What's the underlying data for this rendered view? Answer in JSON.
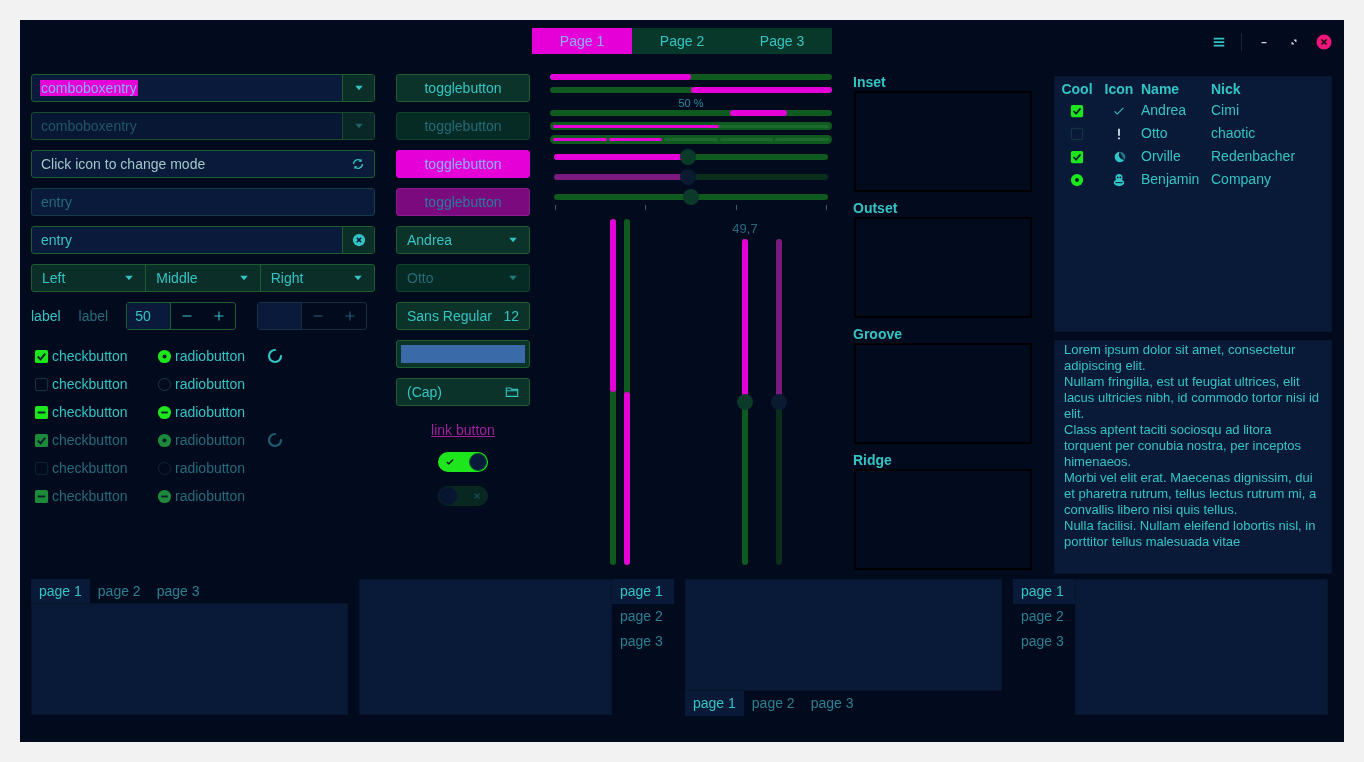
{
  "header": {
    "tabs": [
      {
        "label": "Page 1",
        "selected": true
      },
      {
        "label": "Page 2",
        "selected": false
      },
      {
        "label": "Page 3",
        "selected": false
      }
    ]
  },
  "left": {
    "combo_entries": [
      {
        "value": "comboboxentry",
        "text_selected": true,
        "disabled": false
      },
      {
        "value": "comboboxentry",
        "text_selected": false,
        "disabled": true
      }
    ],
    "mode_entry": {
      "value": "Click icon to change mode"
    },
    "placeholder_entry": {
      "placeholder": "entry"
    },
    "clear_entry": {
      "value": "entry"
    },
    "linked_combos": [
      {
        "label": "Left"
      },
      {
        "label": "Middle"
      },
      {
        "label": "Right"
      }
    ],
    "labels": [
      {
        "text": "label",
        "disabled": false
      },
      {
        "text": "label",
        "disabled": true
      }
    ],
    "spin_buttons": [
      {
        "value": "50",
        "disabled": false
      },
      {
        "disabled": true
      }
    ],
    "check_rows": [
      {
        "check_label": "checkbutton",
        "checked": true,
        "inconsistent": false,
        "radio_label": "radiobutton",
        "radio_selected": true,
        "spinner": true,
        "disabled": false
      },
      {
        "check_label": "checkbutton",
        "checked": false,
        "inconsistent": false,
        "radio_label": "radiobutton",
        "radio_selected": false,
        "spinner": false,
        "disabled": false
      },
      {
        "check_label": "checkbutton",
        "inconsistent": true,
        "radio_label": "radiobutton",
        "spinner": false,
        "disabled": false
      },
      {
        "check_label": "checkbutton",
        "checked": true,
        "inconsistent": false,
        "radio_label": "radiobutton",
        "radio_selected": true,
        "spinner": true,
        "disabled": true
      },
      {
        "check_label": "checkbutton",
        "checked": false,
        "inconsistent": false,
        "radio_label": "radiobutton",
        "radio_selected": false,
        "spinner": false,
        "disabled": true
      },
      {
        "check_label": "checkbutton",
        "inconsistent": true,
        "radio_label": "radiobutton",
        "spinner": false,
        "disabled": true
      }
    ]
  },
  "middle": {
    "toggle_buttons": [
      {
        "label": "togglebutton",
        "active": false,
        "disabled": false
      },
      {
        "label": "togglebutton",
        "active": false,
        "disabled": true
      },
      {
        "label": "togglebutton",
        "active": true,
        "disabled": false
      },
      {
        "label": "togglebutton",
        "active": true,
        "disabled": true
      }
    ],
    "combos": [
      {
        "value": "Andrea",
        "disabled": false
      },
      {
        "value": "Otto",
        "disabled": true
      }
    ],
    "font_button": {
      "font": "Sans Regular",
      "size": "12"
    },
    "color_button": {
      "color": "#3a6aa8"
    },
    "file_button": {
      "label": "(Cap)"
    },
    "link_button": {
      "label": "link button"
    },
    "switches": [
      {
        "on": true,
        "disabled": false
      },
      {
        "on": false,
        "disabled": true
      }
    ]
  },
  "progress": {
    "bars": [
      {
        "kind": "bar",
        "level": 0.5,
        "inverted": false
      },
      {
        "kind": "bar",
        "level": 0.5,
        "inverted": true
      },
      {
        "kind": "pulse",
        "text": "50 %"
      },
      {
        "kind": "thick",
        "level": 0.6
      },
      {
        "kind": "segmented",
        "level": 0.4
      }
    ],
    "scales": [
      {
        "level": 0.49,
        "filled": true,
        "disabled": false
      },
      {
        "level": 0.49,
        "filled": true,
        "disabled": true
      },
      {
        "level": 0.5,
        "filled": false,
        "disabled": false,
        "marks": true
      }
    ],
    "vertical_bars": [
      {
        "level": 0.5,
        "inverted": false
      },
      {
        "level": 0.5,
        "inverted": true
      }
    ],
    "vertical_scales": [
      {
        "level": 0.5,
        "value": "49,7",
        "disabled": false
      },
      {
        "level": 0.5,
        "disabled": true
      }
    ]
  },
  "frames": [
    {
      "label": "Inset"
    },
    {
      "label": "Outset"
    },
    {
      "label": "Groove"
    },
    {
      "label": "Ridge"
    }
  ],
  "tree": {
    "columns": [
      "Cool",
      "Icon",
      "Name",
      "Nick"
    ],
    "rows": [
      {
        "kind": "check",
        "checked": true,
        "name": "Andrea",
        "nick": "Cimi"
      },
      {
        "kind": "check",
        "checked": false,
        "name": "Otto",
        "nick": "chaotic"
      },
      {
        "kind": "check",
        "checked": true,
        "name": "Orville",
        "nick": "Redenbacher"
      },
      {
        "kind": "radio",
        "checked": true,
        "name": "Benjamin",
        "nick": "Company"
      }
    ]
  },
  "text_view": {
    "paragraphs": [
      "Lorem ipsum dolor sit amet, consectetur adipiscing elit.",
      "Nullam fringilla, est ut feugiat ultrices, elit lacus ultricies nibh, id commodo tortor nisi id elit.",
      "Class aptent taciti sociosqu ad litora torquent per conubia nostra, per inceptos himenaeos.",
      "Morbi vel elit erat. Maecenas dignissim, dui et pharetra rutrum, tellus lectus rutrum mi, a convallis libero nisi quis tellus.",
      "Nulla facilisi. Nullam eleifend lobortis nisl, in porttitor tellus malesuada vitae"
    ]
  },
  "notebooks": [
    {
      "kind": "top",
      "tabs": [
        {
          "label": "page 1",
          "selected": true
        },
        {
          "label": "page 2",
          "selected": false
        },
        {
          "label": "page 3",
          "selected": false
        }
      ]
    },
    {
      "kind": "right",
      "tabs": [
        {
          "label": "page 1",
          "selected": true
        },
        {
          "label": "page 2",
          "selected": false
        },
        {
          "label": "page 3",
          "selected": false
        }
      ]
    },
    {
      "kind": "bottom",
      "tabs": [
        {
          "label": "page 1",
          "selected": true
        },
        {
          "label": "page 2",
          "selected": false
        },
        {
          "label": "page 3",
          "selected": false
        }
      ]
    },
    {
      "kind": "left",
      "tabs": [
        {
          "label": "page 1",
          "selected": true
        },
        {
          "label": "page 2",
          "selected": false
        },
        {
          "label": "page 3",
          "selected": false
        }
      ]
    }
  ]
}
